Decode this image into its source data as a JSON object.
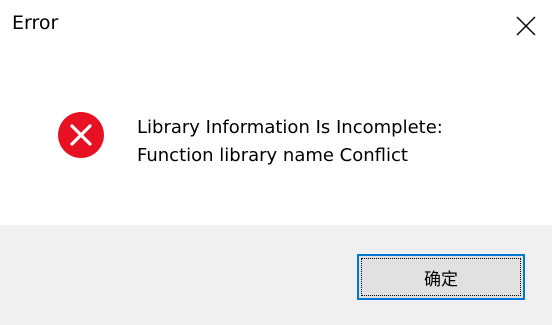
{
  "dialog": {
    "title": "Error",
    "close_icon": "close-icon",
    "error_icon": "error-icon",
    "error_icon_color": "#e81123",
    "message_lines": [
      "Library Information Is Incomplete:",
      "Function library name Conflict"
    ],
    "ok_label": "确定",
    "accent_color": "#0078d7"
  }
}
